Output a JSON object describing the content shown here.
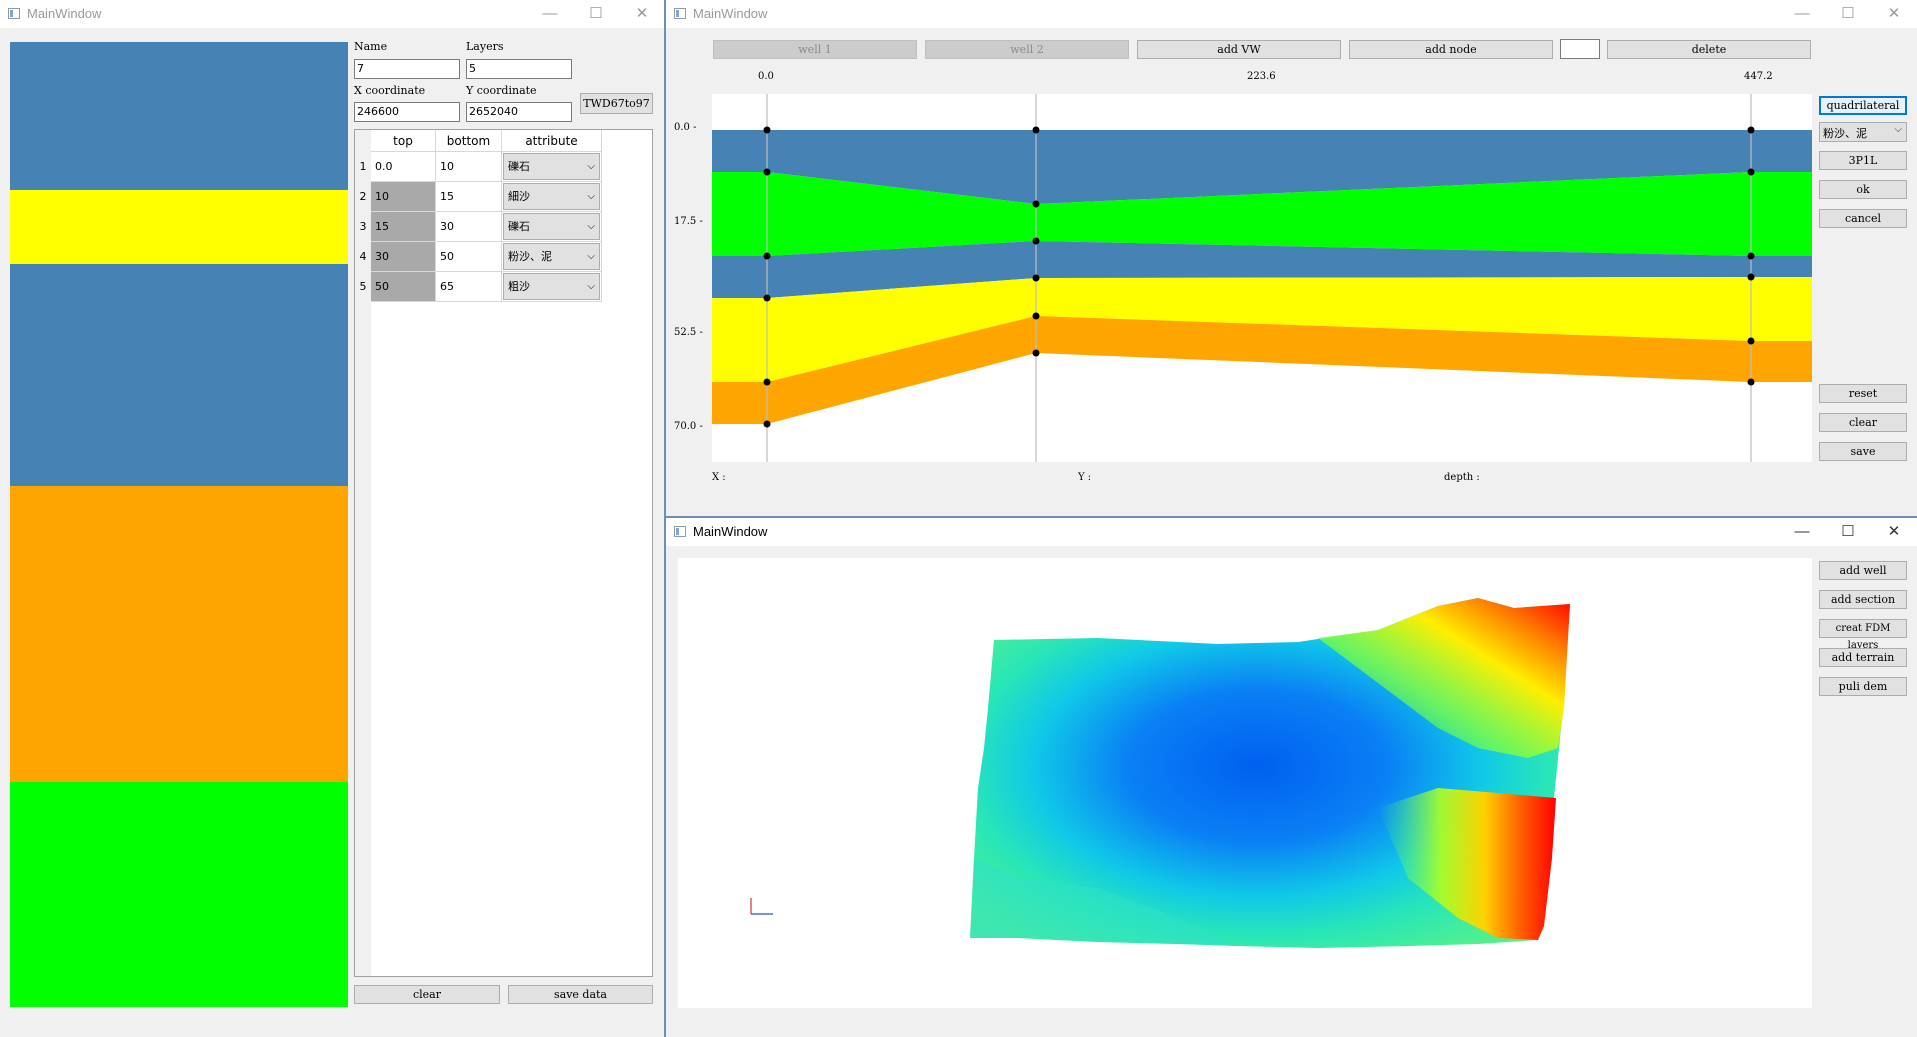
{
  "left_window": {
    "title": "MainWindow",
    "column_colors": [
      "#4682b4",
      "#ffff00",
      "#4682b4",
      "#ffa500",
      "#00ff00"
    ],
    "name_label": "Name",
    "name_value": "7",
    "layers_label": "Layers",
    "layers_value": "5",
    "x_label": "X coordinate",
    "x_value": "246600",
    "y_label": "Y coordinate",
    "y_value": "2652040",
    "convert_button": "TWD67to97",
    "table": {
      "headers": [
        "top",
        "bottom",
        "attribute"
      ],
      "rows": [
        {
          "num": "1",
          "top": "0.0",
          "bottom": "10",
          "attribute": "礫石"
        },
        {
          "num": "2",
          "top": "10",
          "bottom": "15",
          "attribute": "細沙"
        },
        {
          "num": "3",
          "top": "15",
          "bottom": "30",
          "attribute": "礫石"
        },
        {
          "num": "4",
          "top": "30",
          "bottom": "50",
          "attribute": "粉沙、泥"
        },
        {
          "num": "5",
          "top": "50",
          "bottom": "65",
          "attribute": "粗沙"
        }
      ]
    },
    "clear_button": "clear",
    "save_button": "save data"
  },
  "section_window": {
    "title": "MainWindow",
    "toolbar": {
      "well1": "well 1",
      "well2": "well 2",
      "add_vw": "add VW",
      "add_node": "add node",
      "node_input": "",
      "delete": "delete"
    },
    "x_ticks": [
      "0.0",
      "223.6",
      "447.2"
    ],
    "y_ticks": [
      "0.0 -",
      "17.5 -",
      "52.5 -",
      "70.0 -"
    ],
    "status": {
      "x": "X :",
      "y": "Y :",
      "depth": "depth :"
    },
    "side_buttons": {
      "quadrilateral": "quadrilateral",
      "attribute_select": "粉沙、泥",
      "threeP1L": "3P1L",
      "ok": "ok",
      "cancel": "cancel",
      "reset": "reset",
      "clear": "clear",
      "save": "save"
    },
    "colors": {
      "blue": "#4682b4",
      "green": "#00ff00",
      "yellow": "#ffff00",
      "orange": "#ffa500"
    }
  },
  "terrain_window": {
    "title": "MainWindow",
    "buttons": {
      "add_well": "add well",
      "add_section": "add section",
      "creat_fdm": "creat FDM layers",
      "add_terrain": "add terrain",
      "puli_dem": "puli dem"
    }
  }
}
